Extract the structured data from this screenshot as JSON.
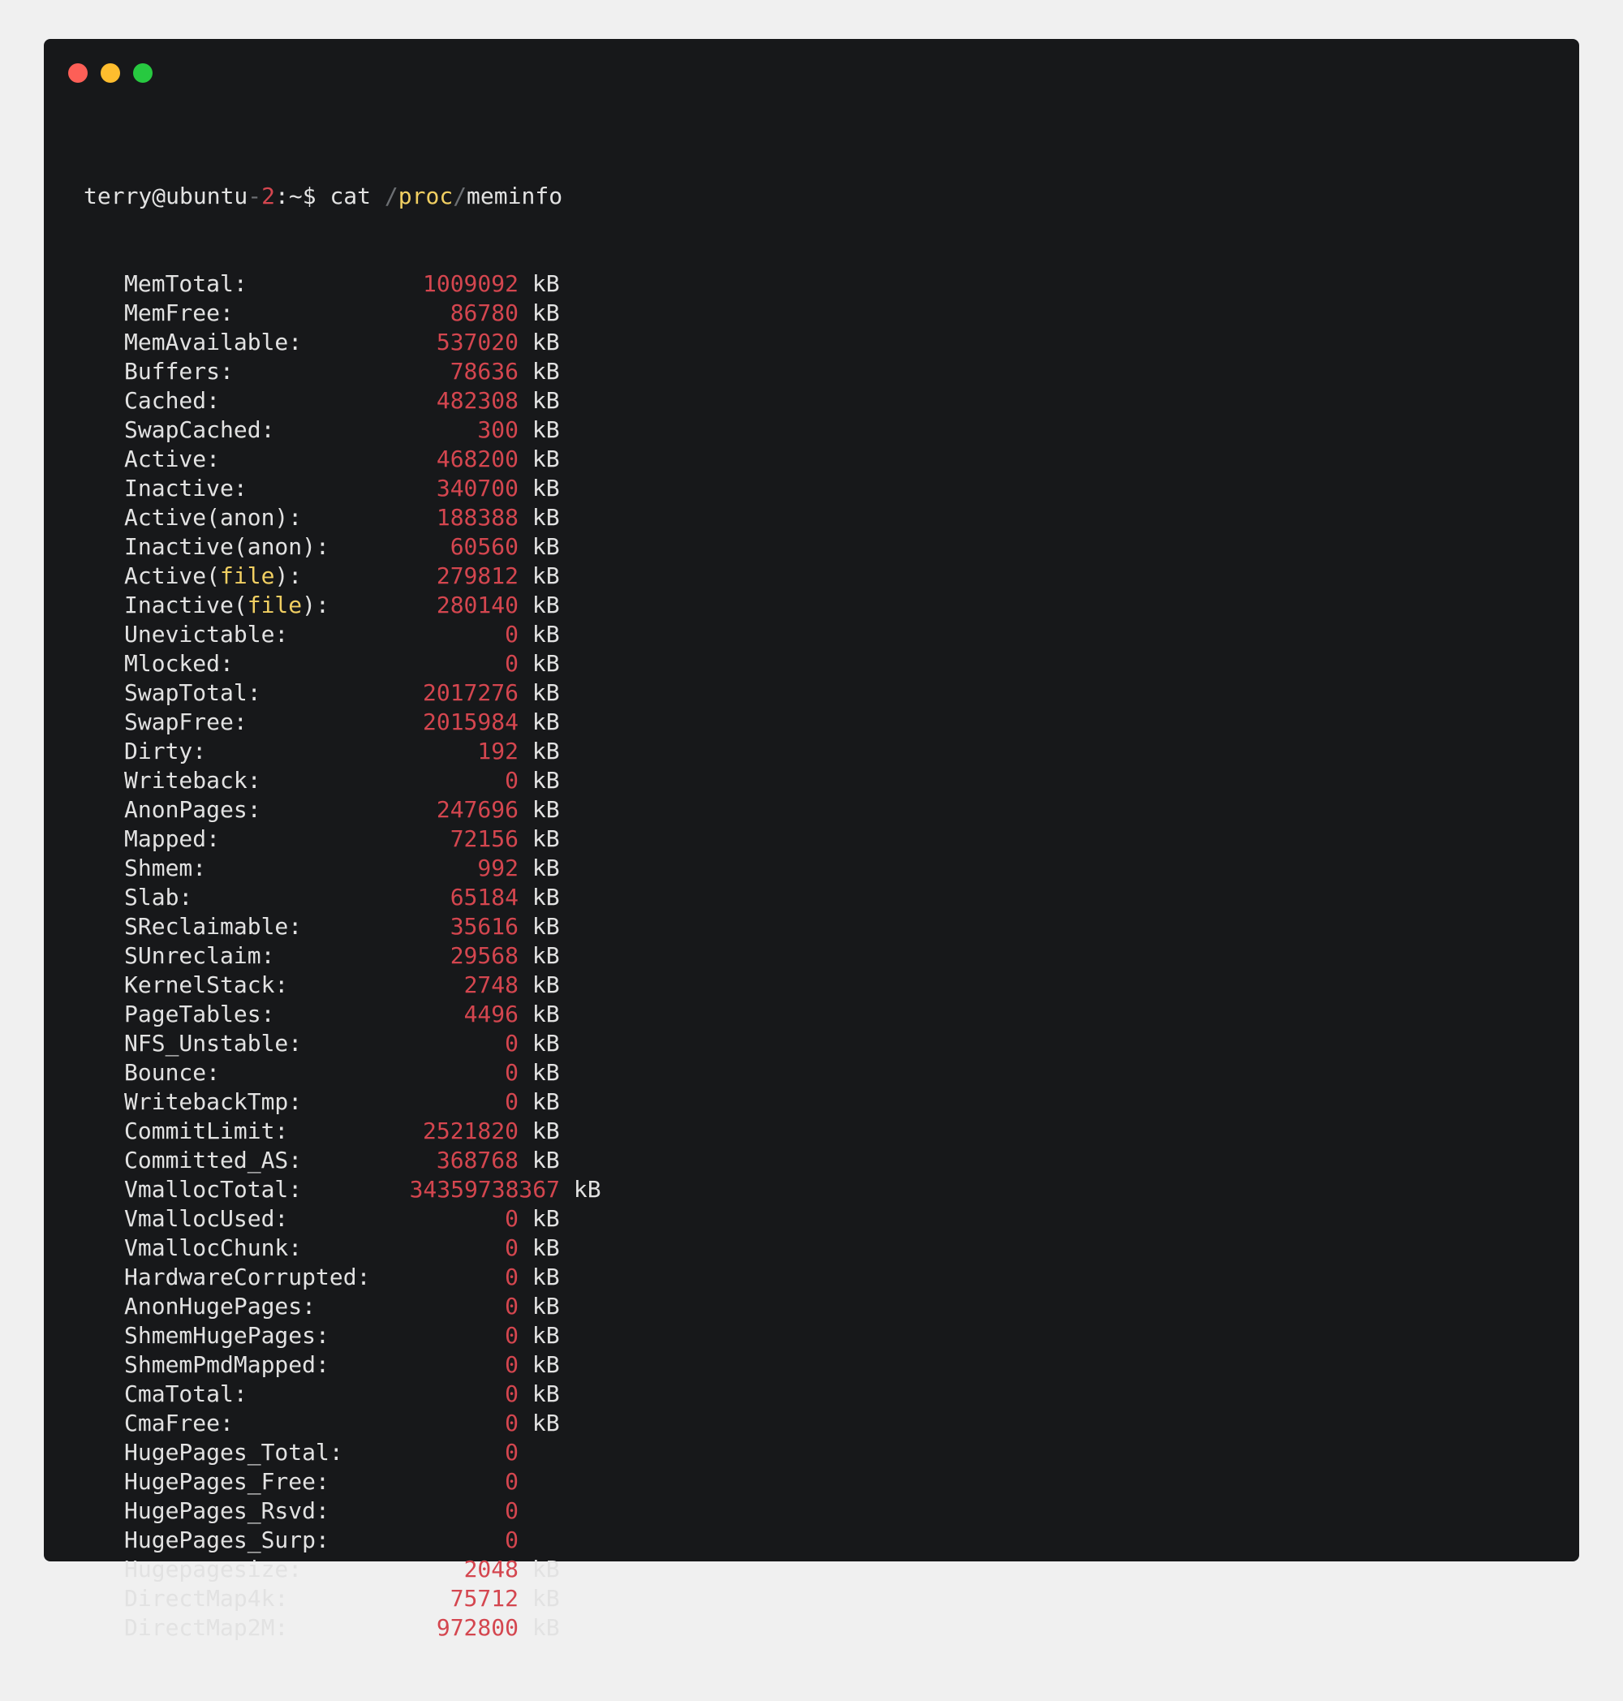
{
  "window": {
    "controls": [
      {
        "name": "close",
        "color": "#fd5f57"
      },
      {
        "name": "minimize",
        "color": "#febd2e"
      },
      {
        "name": "zoom",
        "color": "#27c940"
      }
    ]
  },
  "prompt": {
    "user_host_a": "terry@ubuntu",
    "user_host_dash": "-",
    "user_host_num": "2",
    "path_suffix": ":~$ ",
    "command": "cat ",
    "arg_slash1": "/",
    "arg_dir": "proc",
    "arg_slash2": "/",
    "arg_file": "meminfo"
  },
  "colors": {
    "background": "#17181a",
    "page": "#f0f0f0",
    "text": "#e2e2e2",
    "value": "#d4464f",
    "keyword": "#f1cf62"
  },
  "rows": [
    {
      "label": "MemTotal:",
      "value": "1009092",
      "unit": "kB"
    },
    {
      "label": "MemFree:",
      "value": "86780",
      "unit": "kB"
    },
    {
      "label": "MemAvailable:",
      "value": "537020",
      "unit": "kB"
    },
    {
      "label": "Buffers:",
      "value": "78636",
      "unit": "kB"
    },
    {
      "label": "Cached:",
      "value": "482308",
      "unit": "kB"
    },
    {
      "label": "SwapCached:",
      "value": "300",
      "unit": "kB"
    },
    {
      "label": "Active:",
      "value": "468200",
      "unit": "kB"
    },
    {
      "label": "Inactive:",
      "value": "340700",
      "unit": "kB"
    },
    {
      "label": "Active(anon):",
      "value": "188388",
      "unit": "kB"
    },
    {
      "label": "Inactive(anon):",
      "value": "60560",
      "unit": "kB"
    },
    {
      "label": "Active(file):",
      "label_pre": "Active(",
      "label_kw": "file",
      "label_post": "):",
      "value": "279812",
      "unit": "kB"
    },
    {
      "label": "Inactive(file):",
      "label_pre": "Inactive(",
      "label_kw": "file",
      "label_post": "):",
      "value": "280140",
      "unit": "kB"
    },
    {
      "label": "Unevictable:",
      "value": "0",
      "unit": "kB"
    },
    {
      "label": "Mlocked:",
      "value": "0",
      "unit": "kB"
    },
    {
      "label": "SwapTotal:",
      "value": "2017276",
      "unit": "kB"
    },
    {
      "label": "SwapFree:",
      "value": "2015984",
      "unit": "kB"
    },
    {
      "label": "Dirty:",
      "value": "192",
      "unit": "kB"
    },
    {
      "label": "Writeback:",
      "value": "0",
      "unit": "kB"
    },
    {
      "label": "AnonPages:",
      "value": "247696",
      "unit": "kB"
    },
    {
      "label": "Mapped:",
      "value": "72156",
      "unit": "kB"
    },
    {
      "label": "Shmem:",
      "value": "992",
      "unit": "kB"
    },
    {
      "label": "Slab:",
      "value": "65184",
      "unit": "kB"
    },
    {
      "label": "SReclaimable:",
      "value": "35616",
      "unit": "kB"
    },
    {
      "label": "SUnreclaim:",
      "value": "29568",
      "unit": "kB"
    },
    {
      "label": "KernelStack:",
      "value": "2748",
      "unit": "kB"
    },
    {
      "label": "PageTables:",
      "value": "4496",
      "unit": "kB"
    },
    {
      "label": "NFS_Unstable:",
      "value": "0",
      "unit": "kB"
    },
    {
      "label": "Bounce:",
      "value": "0",
      "unit": "kB"
    },
    {
      "label": "WritebackTmp:",
      "value": "0",
      "unit": "kB"
    },
    {
      "label": "CommitLimit:",
      "value": "2521820",
      "unit": "kB"
    },
    {
      "label": "Committed_AS:",
      "value": "368768",
      "unit": "kB"
    },
    {
      "label": "VmallocTotal:",
      "value": "34359738367",
      "unit": "kB"
    },
    {
      "label": "VmallocUsed:",
      "value": "0",
      "unit": "kB"
    },
    {
      "label": "VmallocChunk:",
      "value": "0",
      "unit": "kB"
    },
    {
      "label": "HardwareCorrupted:",
      "value": "0",
      "unit": "kB"
    },
    {
      "label": "AnonHugePages:",
      "value": "0",
      "unit": "kB"
    },
    {
      "label": "ShmemHugePages:",
      "value": "0",
      "unit": "kB"
    },
    {
      "label": "ShmemPmdMapped:",
      "value": "0",
      "unit": "kB"
    },
    {
      "label": "CmaTotal:",
      "value": "0",
      "unit": "kB"
    },
    {
      "label": "CmaFree:",
      "value": "0",
      "unit": "kB"
    },
    {
      "label": "HugePages_Total:",
      "value": "0",
      "unit": ""
    },
    {
      "label": "HugePages_Free:",
      "value": "0",
      "unit": ""
    },
    {
      "label": "HugePages_Rsvd:",
      "value": "0",
      "unit": ""
    },
    {
      "label": "HugePages_Surp:",
      "value": "0",
      "unit": ""
    },
    {
      "label": "Hugepagesize:",
      "value": "2048",
      "unit": "kB"
    },
    {
      "label": "DirectMap4k:",
      "value": "75712",
      "unit": "kB"
    },
    {
      "label": "DirectMap2M:",
      "value": "972800",
      "unit": "kB"
    }
  ]
}
